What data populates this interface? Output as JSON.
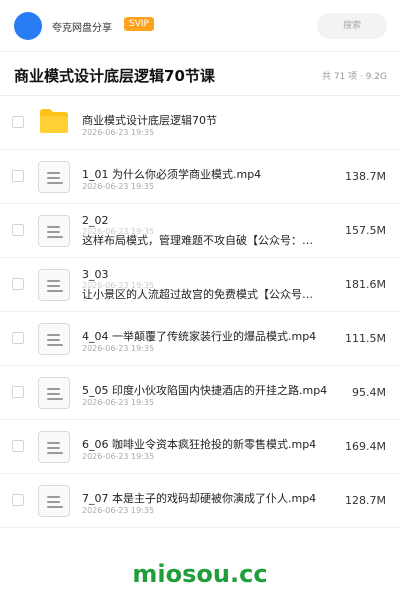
{
  "header": {
    "share_name": "夸克网盘分享",
    "badge": "SVIP",
    "search_placeholder": "搜索"
  },
  "title": "商业模式设计底层逻辑70节课",
  "meta": "共 71 项 · 9.2G",
  "items": [
    {
      "type": "folder",
      "name": "商业模式设计底层逻辑70节",
      "date": "2026-06-23 19:35",
      "size": ""
    },
    {
      "type": "file",
      "name": "1_01 为什么你必须学商业模式.mp4",
      "date": "2026-06-23 19:35",
      "size": "138.7M"
    },
    {
      "type": "file",
      "name": "2_02",
      "subtitle": "这样布局模式，管理难题不攻自破【公众号：…",
      "date": "2026-06-23 19:35",
      "size": "157.5M"
    },
    {
      "type": "file",
      "name": "3_03",
      "subtitle": "让小景区的人流超过故宫的免费模式【公众号…",
      "date": "2026-06-23 19:35",
      "size": "181.6M"
    },
    {
      "type": "file",
      "name": "4_04 一举颠覆了传统家装行业的爆品模式.mp4",
      "date": "2026-06-23 19:35",
      "size": "111.5M"
    },
    {
      "type": "file",
      "name": "5_05 印度小伙攻陷国内快捷酒店的开挂之路.mp4",
      "date": "2026-06-23 19:35",
      "size": "95.4M"
    },
    {
      "type": "file",
      "name": "6_06 咖啡业令资本疯狂抢投的新零售模式.mp4",
      "date": "2026-06-23 19:35",
      "size": "169.4M"
    },
    {
      "type": "file",
      "name": "7_07 本是主子的戏码却硬被你演成了仆人.mp4",
      "date": "2026-06-23 19:35",
      "size": "128.7M"
    }
  ],
  "watermark": "miosou.cc",
  "colors": {
    "avatar": "#2a7cf5",
    "badge": "#ffa21f",
    "folder": "#ffc21a",
    "watermark": "#1f9e3a"
  }
}
